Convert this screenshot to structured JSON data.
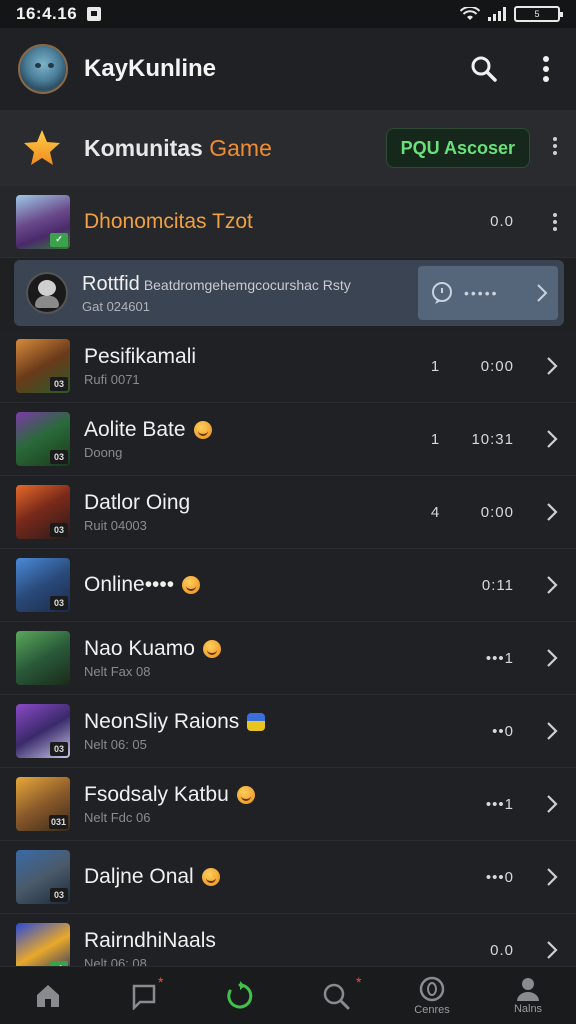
{
  "status": {
    "time": "16:4.16",
    "battery": "5"
  },
  "app_bar": {
    "title": "KayKunline"
  },
  "community": {
    "title": "Komunitas",
    "title_accent": "Game",
    "pill_label": "PQU Ascoser"
  },
  "first_row": {
    "name": "Dhonomcitas Tzot",
    "time": "0.0"
  },
  "highlight": {
    "title": "Rottfid",
    "title_extra": "Beatdromgehemgcocurshac Rsty",
    "subtitle": "Gat 024601",
    "action_label": "•••••"
  },
  "rows": [
    {
      "name": "Pesifikamali",
      "sub": "Rufi 0071",
      "count": "1",
      "time": "0:00",
      "badge": "03"
    },
    {
      "name": "Aolite Bate",
      "sub": "Doong",
      "count": "1",
      "time": "10:31",
      "badge": "03"
    },
    {
      "name": "Datlor Oing",
      "sub": "Ruit 04003",
      "count": "4",
      "time": "0:00",
      "badge": "03"
    },
    {
      "name": "Online••••",
      "sub": "",
      "count": "",
      "time": "0:11",
      "badge": "03"
    },
    {
      "name": "Nao Kuamo",
      "sub": "Nelt Fax 08",
      "count": "",
      "time": "•••1",
      "badge": ""
    },
    {
      "name": "NeonSliy Raions",
      "sub": "Nelt 06: 05",
      "count": "",
      "time": "••0",
      "badge": "03"
    },
    {
      "name": "Fsodsaly Katbu",
      "sub": "Nelt Fdc 06",
      "count": "",
      "time": "•••1",
      "badge": "031"
    },
    {
      "name": "Daljne Onal",
      "sub": "",
      "count": "",
      "time": "•••0",
      "badge": "03"
    },
    {
      "name": "RairndhiNaals",
      "sub": "Nelt 06: 08",
      "count": "",
      "time": "0.0",
      "badge": ""
    }
  ],
  "nav": {
    "item4_label": "Cenres",
    "item5_label": "Nalns"
  },
  "colors": {
    "accent_orange": "#f08c32",
    "accent_green": "#6ae07a",
    "highlight_bg": "#3b4452"
  }
}
